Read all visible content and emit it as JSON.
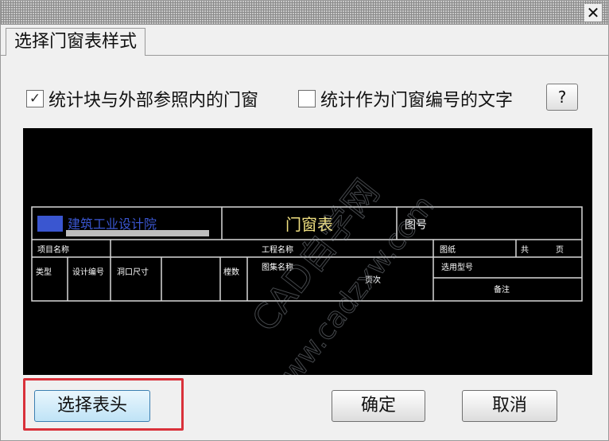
{
  "window": {
    "close_label": "✕"
  },
  "tab": {
    "label": "选择门窗表样式"
  },
  "options": {
    "chk1": {
      "label": "统计块与外部参照内的门窗",
      "checked": "✓"
    },
    "chk2": {
      "label": "统计作为门窗编号的文字",
      "checked": ""
    },
    "help_label": "?"
  },
  "preview": {
    "logo_text": "建筑工业设计院",
    "table_title": "门窗表",
    "code_label": "图号",
    "row2": [
      "项目名称",
      "工程名称",
      "图纸",
      "共",
      "页"
    ],
    "row3": [
      "类型",
      "设计编号",
      "洞口尺寸",
      "樘数",
      "图集名称",
      "页次",
      "选用型号",
      "备注"
    ],
    "watermark": [
      "CAD自学网",
      "www.cadzxw.com"
    ]
  },
  "buttons": {
    "select_header": "选择表头",
    "ok": "确定",
    "cancel": "取消"
  },
  "colors": {
    "cad_line": "#d8d8d8",
    "cad_text": "#ffffff",
    "cad_title": "#f0e080",
    "cad_logo": "#3a56d0",
    "highlight": "#d9313a"
  }
}
